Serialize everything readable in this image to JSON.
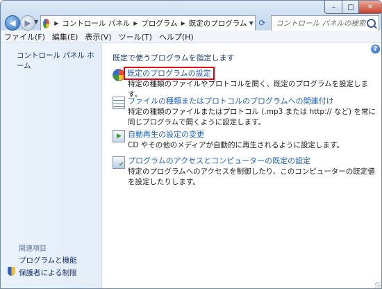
{
  "window": {
    "close_glyph": "✕",
    "max_glyph": "□",
    "min_glyph": "–"
  },
  "address": {
    "crumbs": [
      "コントロール パネル",
      "プログラム",
      "既定のプログラム"
    ],
    "sep": "▶"
  },
  "search": {
    "placeholder": "コントロール パネルの検索"
  },
  "menu": [
    "ファイル(F)",
    "編集(E)",
    "表示(V)",
    "ツール(T)",
    "ヘルプ(H)"
  ],
  "sidebar": {
    "home": "コントロール パネル ホーム",
    "related_heading": "関連項目",
    "links": [
      "プログラムと機能",
      "保護者による制限"
    ]
  },
  "main": {
    "heading": "既定で使うプログラムを指定します",
    "items": [
      {
        "title": "既定のプログラムの設定",
        "desc": "特定の種類のファイルやプロトコルを開く、既定のプログラムを設定します。",
        "icon": "default-programs-icon"
      },
      {
        "title": "ファイルの種類またはプロトコルのプログラムへの関連付け",
        "desc": "特定の種類のファイルまたはプロトコル (.mp3 または http:// など) を常に同じプログラムで開くように設定します。",
        "icon": "file-association-icon"
      },
      {
        "title": "自動再生の設定の変更",
        "desc": "CD やその他のメディアが自動的に再生されるように設定します。",
        "icon": "autoplay-icon"
      },
      {
        "title": "プログラムのアクセスとコンピューターの既定の設定",
        "desc": "特定のプログラムへのアクセスを制御したり、このコンピューターの既定値を設定したりします。",
        "icon": "program-access-icon"
      }
    ]
  },
  "highlight_color": "#e60012"
}
